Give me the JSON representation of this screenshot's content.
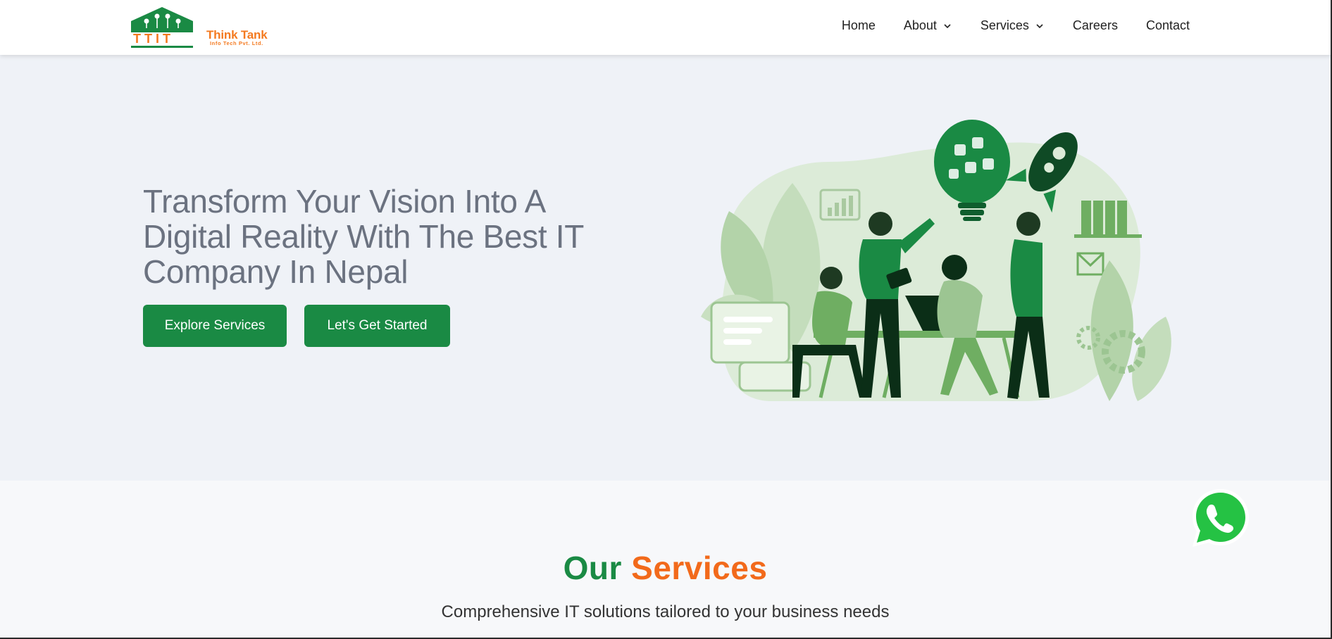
{
  "brand": {
    "logo_letters": "TTIT",
    "name_line1": "Think Tank",
    "name_line2": "Info Tech Pvt. Ltd.",
    "green": "#1a8a44",
    "orange": "#f47a20"
  },
  "nav": {
    "items": [
      {
        "label": "Home",
        "dropdown": false
      },
      {
        "label": "About",
        "dropdown": true
      },
      {
        "label": "Services",
        "dropdown": true
      },
      {
        "label": "Careers",
        "dropdown": false
      },
      {
        "label": "Contact",
        "dropdown": false
      }
    ]
  },
  "hero": {
    "title": "Transform Your Vision Into A Digital Reality With The Best IT Company In Nepal",
    "primary_button": "Explore Services",
    "secondary_button": "Let's Get Started",
    "illustration_icon": "team-collaboration-illustration"
  },
  "services": {
    "title_word1": "Our",
    "title_word2": "Services",
    "subtitle": "Comprehensive IT solutions tailored to your business needs"
  },
  "floating": {
    "whatsapp_icon": "whatsapp-icon"
  }
}
